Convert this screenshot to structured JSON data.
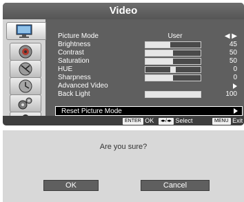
{
  "menu": {
    "title": "Video",
    "items": [
      {
        "label": "Picture Mode",
        "center": "User"
      },
      {
        "label": "Brightness",
        "value": "45",
        "level": 0.45
      },
      {
        "label": "Contrast",
        "value": "50",
        "level": 0.5
      },
      {
        "label": "Saturation",
        "value": "50",
        "level": 0.5
      },
      {
        "label": "HUE",
        "value": "0",
        "level": 0.5
      },
      {
        "label": "Sharpness",
        "value": "0",
        "level": 0.5
      },
      {
        "label": "Advanced Video"
      },
      {
        "label": "Back Light",
        "value": "100",
        "level": 1.0
      },
      {
        "label": "Reset Picture Mode"
      }
    ],
    "icons": [
      "picture-icon",
      "audio-icon",
      "satellite-dish-icon",
      "clock-icon",
      "setup-gears-icon",
      "lock-icon"
    ],
    "footer": {
      "enter_key": "ENTER",
      "enter_action": "OK",
      "nav_key": "◂▸/◂▸",
      "nav_action": "Select",
      "menu_key": "MENU",
      "menu_action": "Exit"
    }
  },
  "dialog": {
    "message": "Are you sure?",
    "ok_label": "OK",
    "cancel_label": "Cancel"
  },
  "colors": {
    "menu_bg": "#5f5f5f",
    "highlight_bg": "#000000",
    "dialog_bg": "#d8d8d8"
  }
}
